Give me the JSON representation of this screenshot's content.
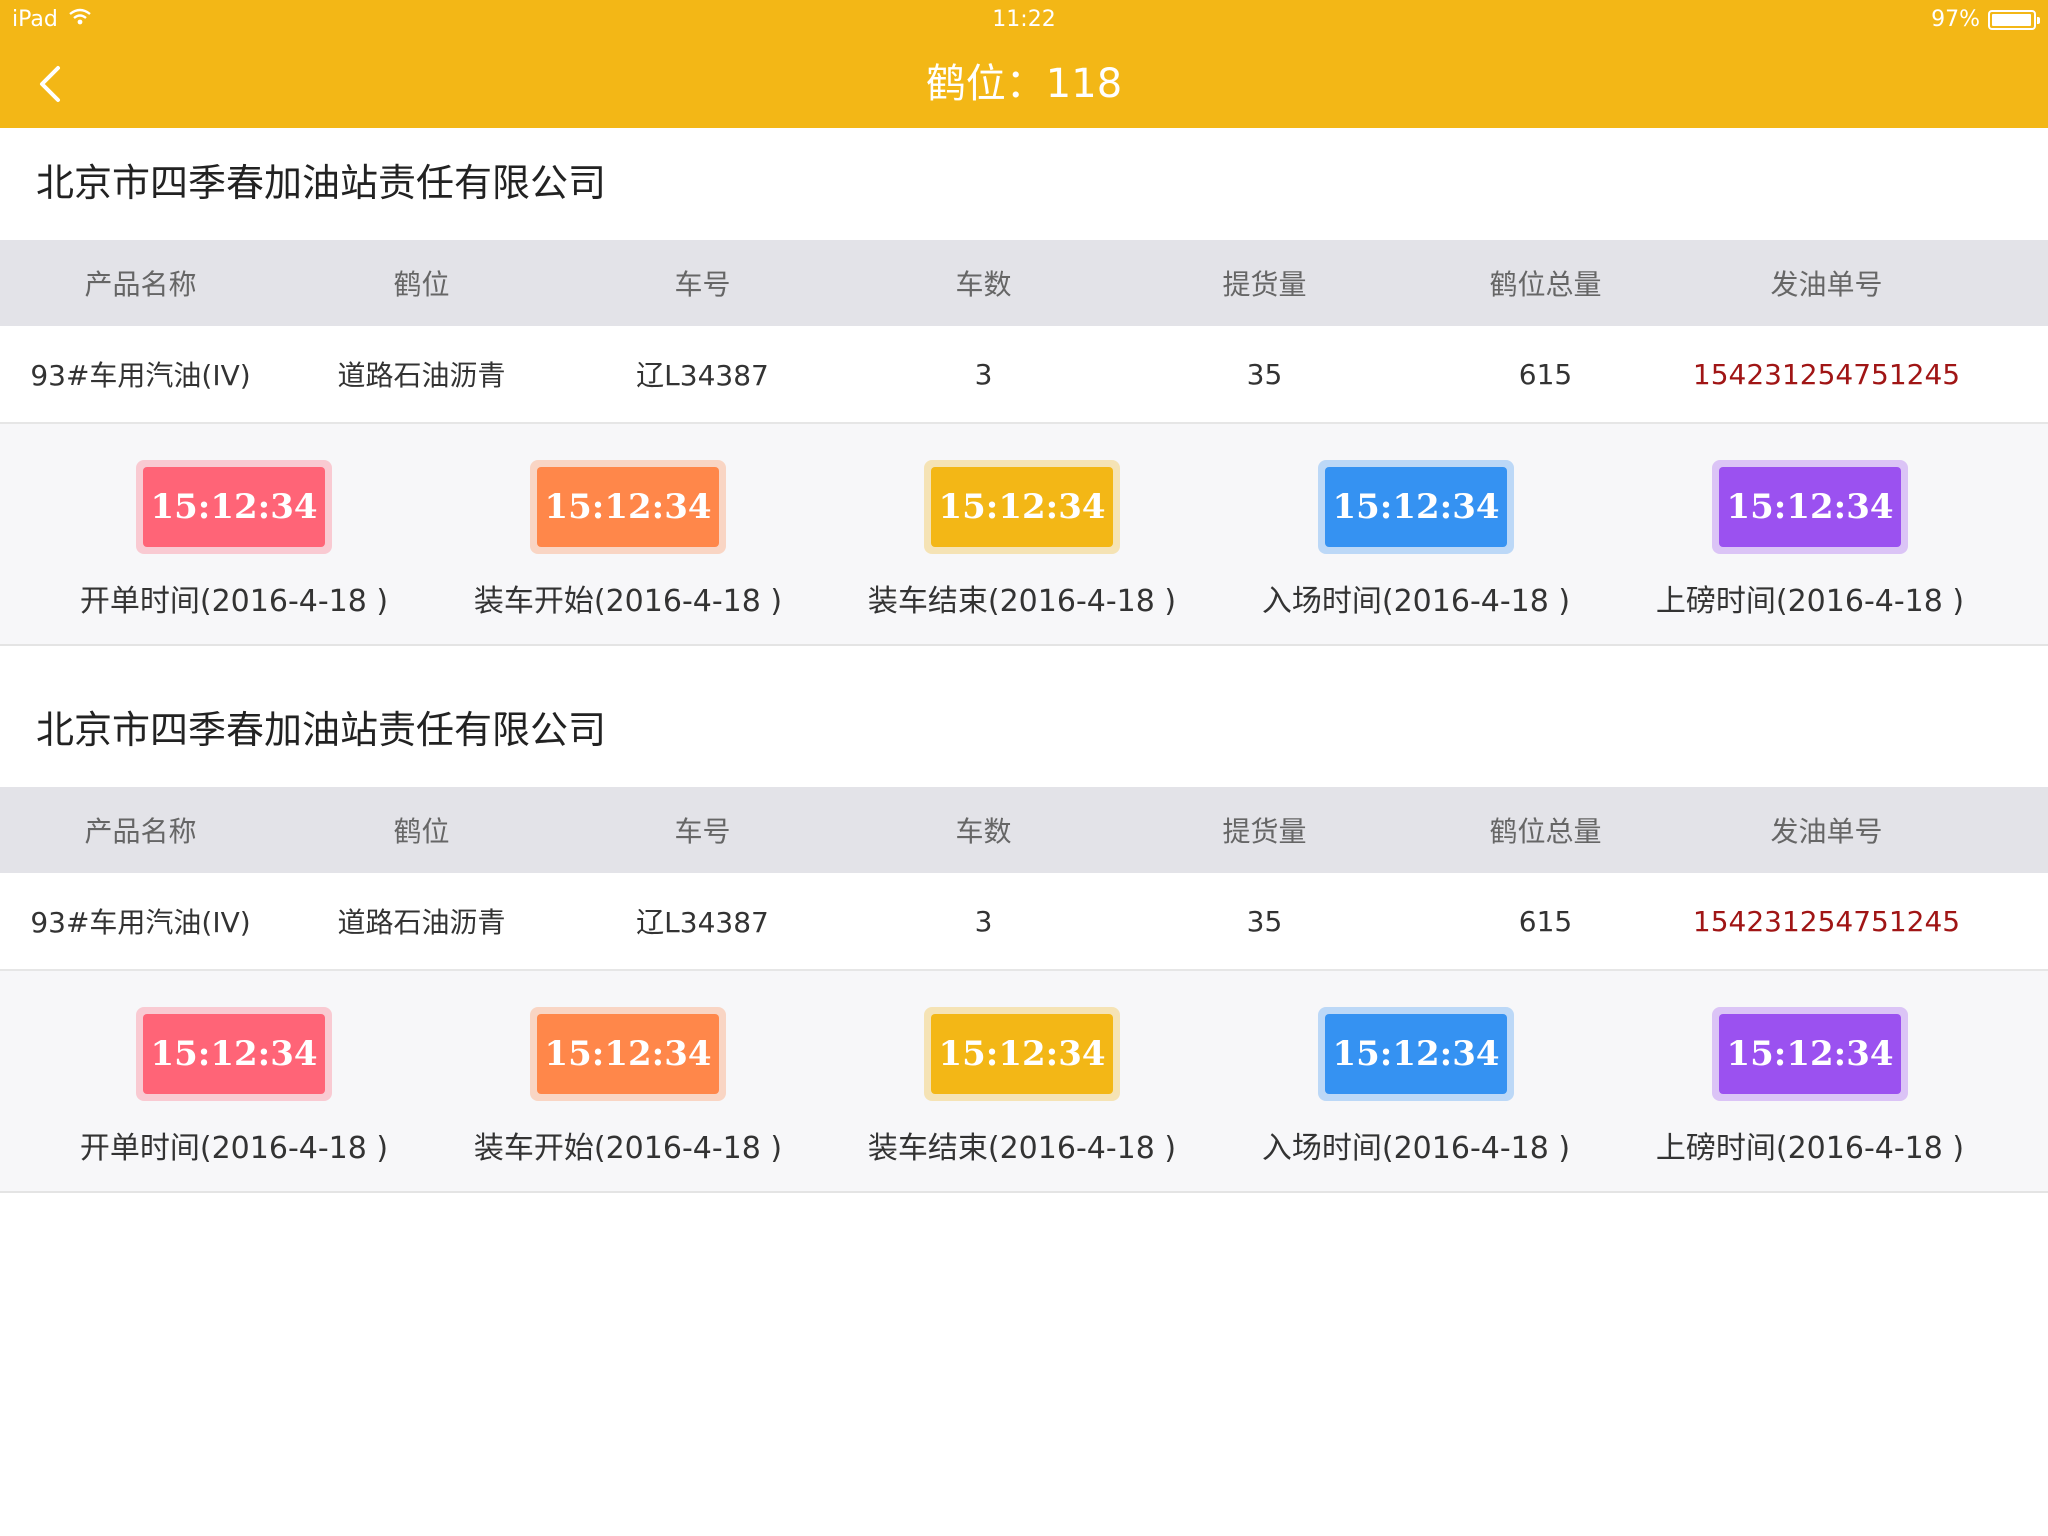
{
  "status_bar": {
    "device": "iPad",
    "time": "11:22",
    "battery": "97%",
    "battery_level": 0.97
  },
  "nav": {
    "title": "鹤位：118"
  },
  "columns": [
    "产品名称",
    "鹤位",
    "车号",
    "车数",
    "提货量",
    "鹤位总量",
    "发油单号"
  ],
  "colors": {
    "header_bg": "#f3b716",
    "order_number": "#a01515",
    "badge_red": "#ff6477",
    "badge_orange": "#ff874a",
    "badge_yellow": "#f3b716",
    "badge_blue": "#3592f2",
    "badge_purple": "#9b51f0"
  },
  "records": [
    {
      "company": "北京市四季春加油站责任有限公司",
      "cells": [
        "93#车用汽油(IV)",
        "道路石油沥青",
        "辽L34387",
        "3",
        "35",
        "615",
        "154231254751245"
      ],
      "times": [
        {
          "time": "15:12:34",
          "label": "开单时间(2016-4-18 )",
          "color": "red"
        },
        {
          "time": "15:12:34",
          "label": "装车开始(2016-4-18 )",
          "color": "orange"
        },
        {
          "time": "15:12:34",
          "label": "装车结束(2016-4-18 )",
          "color": "yellow"
        },
        {
          "time": "15:12:34",
          "label": "入场时间(2016-4-18 )",
          "color": "blue"
        },
        {
          "time": "15:12:34",
          "label": "上磅时间(2016-4-18 )",
          "color": "purple"
        }
      ]
    },
    {
      "company": "北京市四季春加油站责任有限公司",
      "cells": [
        "93#车用汽油(IV)",
        "道路石油沥青",
        "辽L34387",
        "3",
        "35",
        "615",
        "154231254751245"
      ],
      "times": [
        {
          "time": "15:12:34",
          "label": "开单时间(2016-4-18 )",
          "color": "red"
        },
        {
          "time": "15:12:34",
          "label": "装车开始(2016-4-18 )",
          "color": "orange"
        },
        {
          "time": "15:12:34",
          "label": "装车结束(2016-4-18 )",
          "color": "yellow"
        },
        {
          "time": "15:12:34",
          "label": "入场时间(2016-4-18 )",
          "color": "blue"
        },
        {
          "time": "15:12:34",
          "label": "上磅时间(2016-4-18 )",
          "color": "purple"
        }
      ]
    }
  ]
}
